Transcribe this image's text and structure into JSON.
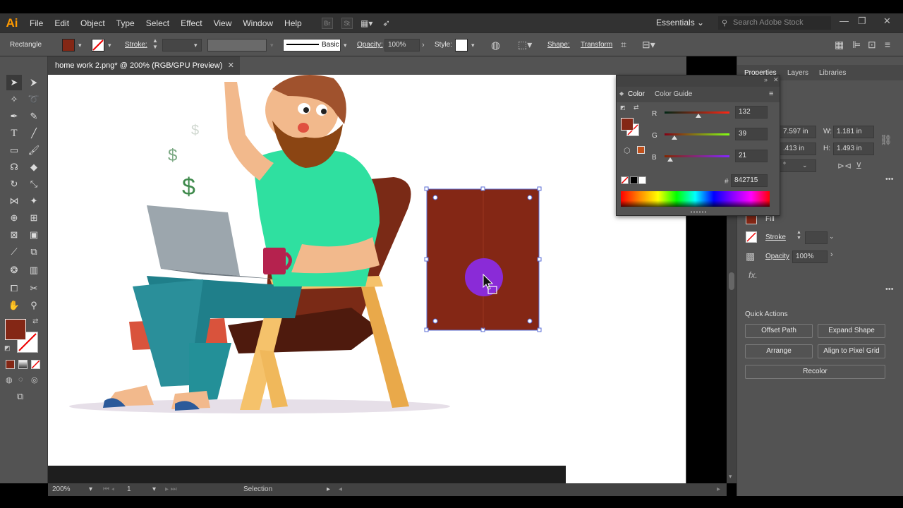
{
  "app": {
    "logo": "Ai"
  },
  "menu": [
    "File",
    "Edit",
    "Object",
    "Type",
    "Select",
    "Effect",
    "View",
    "Window",
    "Help"
  ],
  "menubar_icons": [
    "bridge-icon",
    "stock-icon",
    "arrange-documents-icon",
    "gpu-rocket-icon"
  ],
  "workspace": "Essentials",
  "stock_search_placeholder": "Search Adobe Stock",
  "control": {
    "selection_type": "Rectangle",
    "stroke_label": "Stroke:",
    "brush": "Basic",
    "opacity_label": "Opacity:",
    "opacity_value": "100%",
    "style_label": "Style:",
    "shape_label": "Shape:",
    "transform_label": "Transform"
  },
  "document": {
    "tab_title": "home work 2.png* @ 200% (RGB/GPU Preview)"
  },
  "status": {
    "zoom": "200%",
    "page": "1",
    "tool": "Selection"
  },
  "colors": {
    "fill": "#842715",
    "accent_cursor": "#8a2be2"
  },
  "color_panel": {
    "tabs": [
      "Color",
      "Color Guide"
    ],
    "sliders": [
      {
        "label": "R",
        "value": "132",
        "fraction": 0.518
      },
      {
        "label": "G",
        "value": "39",
        "fraction": 0.153
      },
      {
        "label": "B",
        "value": "21",
        "fraction": 0.082
      }
    ],
    "hex_label": "#",
    "hex_value": "842715"
  },
  "properties": {
    "tabs": [
      "Properties",
      "Layers",
      "Libraries"
    ],
    "x_value": "7.597 in",
    "y_value": ".413 in",
    "w_label": "W:",
    "w_value": "1.181 in",
    "h_label": "H:",
    "h_value": "1.493 in",
    "angle_value": "°",
    "fill_label": "Fill",
    "stroke_label": "Stroke",
    "opacity_label": "Opacity",
    "opacity_value": "100%",
    "fx_label": "fx.",
    "quick_actions_label": "Quick Actions",
    "buttons": [
      "Offset Path",
      "Expand Shape",
      "Arrange",
      "Align to Pixel Grid",
      "Recolor"
    ]
  }
}
